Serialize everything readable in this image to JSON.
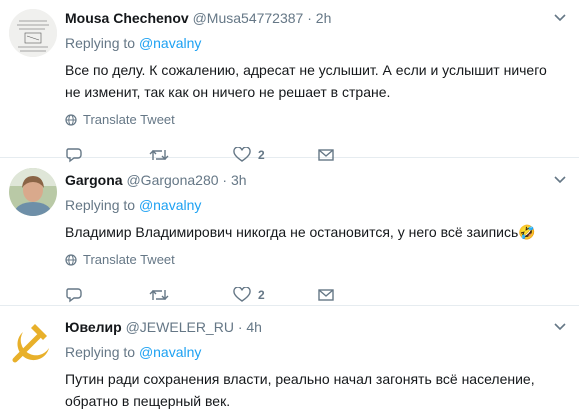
{
  "tweets": [
    {
      "name": "Mousa Chechenov",
      "handle": "@Musa54772387",
      "dot": "·",
      "time": "2h",
      "replying_prefix": "Replying to",
      "replying_to": "@navalny",
      "text_lines": [
        "Все по делу. К сожалению, адресат не услышит. А если и услышит ничего",
        "не изменит, так как он ничего не решает в стране."
      ],
      "translate": "Translate Tweet",
      "reply_count": "",
      "retweet_count": "",
      "like_count": "2",
      "avatar": "sketch-avatar"
    },
    {
      "name": "Gargona",
      "handle": "@Gargona280",
      "dot": "·",
      "time": "3h",
      "replying_prefix": "Replying to",
      "replying_to": "@navalny",
      "text_lines": [
        "Владимир Владимирович никогда не остановится, у него всё заипись🤣"
      ],
      "translate": "Translate Tweet",
      "reply_count": "",
      "retweet_count": "",
      "like_count": "2",
      "avatar": "photo-avatar"
    },
    {
      "name": "Ювелир",
      "handle": "@JEWELER_RU",
      "dot": "·",
      "time": "4h",
      "replying_prefix": "Replying to",
      "replying_to": "@navalny",
      "text_lines": [
        "Путин ради сохранения власти, реально начал загонять всё население,",
        "обратно в пещерный век."
      ],
      "avatar": "hammer-sickle-icon"
    }
  ],
  "colors": {
    "link": "#1da1f2",
    "muted": "#657786",
    "border": "#e6ecf0",
    "hammer_sickle": "#e8b02a"
  }
}
